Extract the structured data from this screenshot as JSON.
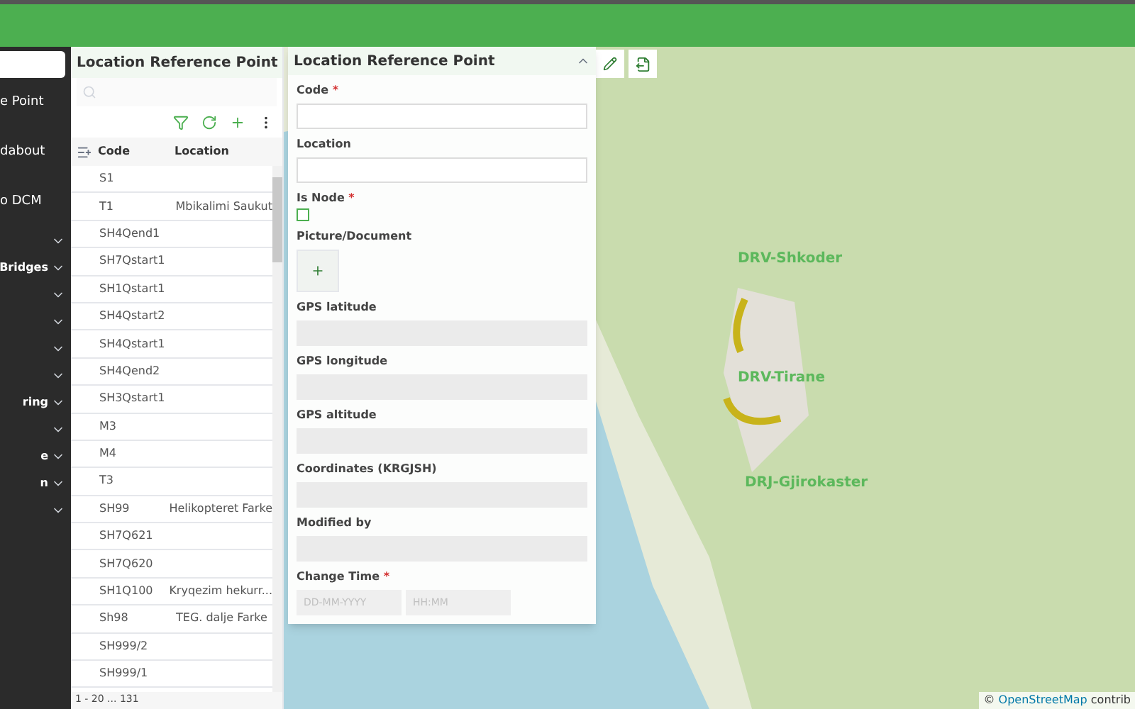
{
  "sidebar": {
    "items": [
      {
        "label": "e Point",
        "kind": "link"
      },
      {
        "label": "dabout",
        "kind": "link"
      },
      {
        "label": "o DCM",
        "kind": "link"
      },
      {
        "kind": "group"
      },
      {
        "label": "Bridges",
        "kind": "group"
      },
      {
        "kind": "group"
      },
      {
        "kind": "group"
      },
      {
        "kind": "group"
      },
      {
        "kind": "group"
      },
      {
        "label": "ring",
        "kind": "group"
      },
      {
        "kind": "group"
      },
      {
        "label": "e",
        "kind": "group"
      },
      {
        "label": "n",
        "kind": "group"
      },
      {
        "kind": "group"
      }
    ]
  },
  "list": {
    "title": "Location Reference Point",
    "columns": [
      "Code",
      "Location"
    ],
    "rows": [
      [
        "S1",
        ""
      ],
      [
        "T1",
        "Mbikalimi Saukut"
      ],
      [
        "SH4Qend1",
        ""
      ],
      [
        "SH7Qstart1",
        ""
      ],
      [
        "SH1Qstart1",
        ""
      ],
      [
        "SH4Qstart2",
        ""
      ],
      [
        "SH4Qstart1",
        ""
      ],
      [
        "SH4Qend2",
        ""
      ],
      [
        "SH3Qstart1",
        ""
      ],
      [
        "M3",
        ""
      ],
      [
        "M4",
        ""
      ],
      [
        "T3",
        ""
      ],
      [
        "SH99",
        "Helikopteret Farke"
      ],
      [
        "SH7Q621",
        ""
      ],
      [
        "SH7Q620",
        ""
      ],
      [
        "SH1Q100",
        "Kryqezim hekurr..."
      ],
      [
        "Sh98",
        "TEG. dalje Farke"
      ],
      [
        "SH999/2",
        ""
      ],
      [
        "SH999/1",
        ""
      ]
    ],
    "pagination": "1 - 20 ... 131"
  },
  "form": {
    "title": "Location Reference Point",
    "fields": [
      {
        "label": "Code",
        "required_mark": "*",
        "kind": "text"
      },
      {
        "label": "Location",
        "kind": "text"
      },
      {
        "label": "Is Node",
        "required_mark": "*",
        "kind": "checkbox",
        "checked": false
      },
      {
        "label": "Picture/Document",
        "kind": "upload"
      },
      {
        "label": "GPS latitude",
        "kind": "readonly"
      },
      {
        "label": "GPS longitude",
        "kind": "readonly"
      },
      {
        "label": "GPS altitude",
        "kind": "readonly"
      },
      {
        "label": "Coordinates (KRGJSH)",
        "kind": "readonly"
      },
      {
        "label": "Modified by",
        "kind": "readonly"
      },
      {
        "label": "Change Time",
        "required_mark": "*",
        "kind": "datetime",
        "placeholders": [
          "DD-MM-YYYY",
          "HH:MM"
        ]
      }
    ]
  },
  "map": {
    "regions": [
      "DRV-Shkoder",
      "DRV-Tirane",
      "DRJ-Gjirokaster"
    ],
    "attribution_symbol": "©",
    "attribution_link": "OpenStreetMap",
    "attribution_rest": "contrib"
  }
}
